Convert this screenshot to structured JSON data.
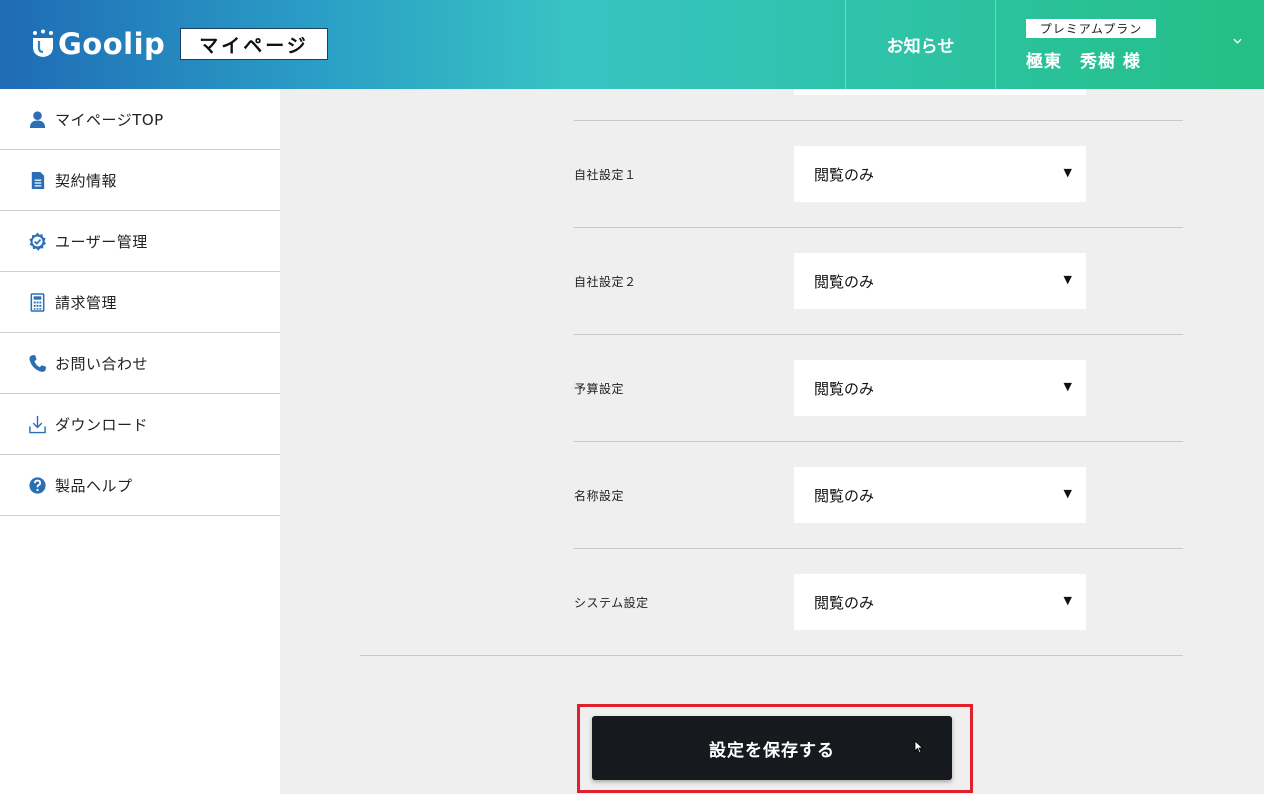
{
  "header": {
    "logo_text": "Goolip",
    "mypage_label": "マイページ",
    "notice_label": "お知らせ",
    "plan_label": "プレミアムプラン",
    "user_name": "極東　秀樹 様",
    "caret_icon": "chevron-down-icon"
  },
  "colors": {
    "header_gradient_start": "#1f6bb5",
    "header_gradient_mid": "#38c3c3",
    "header_gradient_end": "#24bf85",
    "icon_blue": "#2a6fb6",
    "save_button": "#16191d",
    "highlight_red": "#e0202a"
  },
  "sidebar": {
    "items": [
      {
        "label": "マイページTOP",
        "icon": "user-icon"
      },
      {
        "label": "契約情報",
        "icon": "document-icon"
      },
      {
        "label": "ユーザー管理",
        "icon": "gear-check-icon"
      },
      {
        "label": "請求管理",
        "icon": "calculator-icon"
      },
      {
        "label": "お問い合わせ",
        "icon": "phone-icon"
      },
      {
        "label": "ダウンロード",
        "icon": "download-icon"
      },
      {
        "label": "製品ヘルプ",
        "icon": "help-icon"
      }
    ]
  },
  "settings": {
    "rows": [
      {
        "label": "自社設定１",
        "value": "閲覧のみ"
      },
      {
        "label": "自社設定２",
        "value": "閲覧のみ"
      },
      {
        "label": "予算設定",
        "value": "閲覧のみ"
      },
      {
        "label": "名称設定",
        "value": "閲覧のみ"
      },
      {
        "label": "システム設定",
        "value": "閲覧のみ"
      }
    ],
    "arrow_glyph": "▼"
  },
  "actions": {
    "save_label": "設定を保存する"
  }
}
